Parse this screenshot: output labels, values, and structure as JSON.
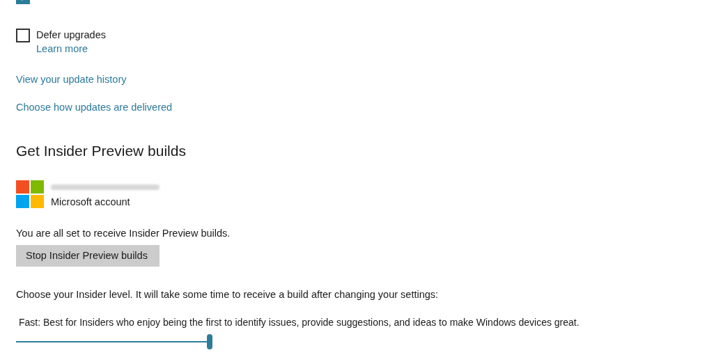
{
  "top_option": {
    "checked": true
  },
  "defer_upgrades": {
    "label": "Defer upgrades",
    "checked": false,
    "link": "Learn more"
  },
  "links": [
    "View your update history",
    "Choose how updates are delivered"
  ],
  "insider": {
    "heading": "Get Insider Preview builds",
    "account": {
      "type": "Microsoft account"
    },
    "status": "You are all set to receive Insider Preview builds.",
    "button": "Stop Insider Preview builds",
    "level_prompt": "Choose your Insider level. It will take some time to receive a build after changing your settings:",
    "level_description": "Fast: Best for Insiders who enjoy being the first to identify issues, provide suggestions, and ideas to make Windows devices great.",
    "slider": {
      "level": 1
    }
  }
}
